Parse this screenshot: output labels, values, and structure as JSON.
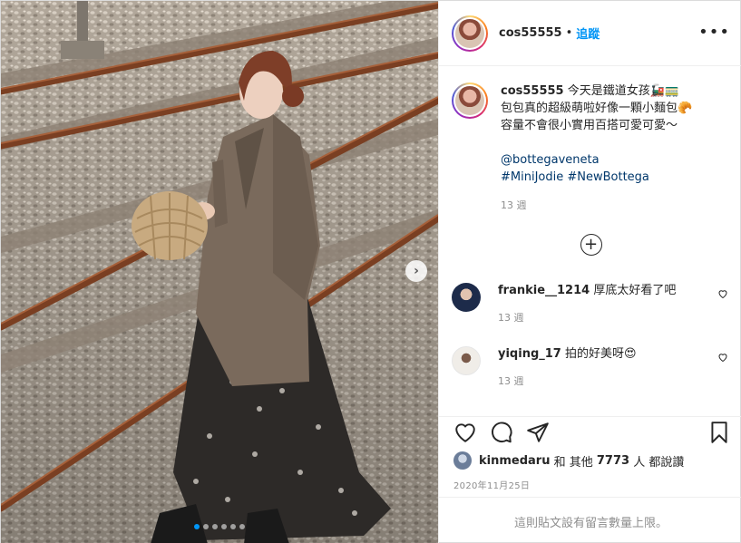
{
  "post": {
    "username": "cos55555",
    "header_separator": "•",
    "follow_label": "追蹤",
    "more_label": "•••",
    "next_label": "›",
    "slide_count": 6,
    "active_slide": 0
  },
  "caption": {
    "username": "cos55555",
    "lines": [
      "今天是鐵道女孩🚂🚃",
      "包包真的超級萌啦好像一顆小麵包🥐",
      "容量不會很小實用百搭可愛可愛～"
    ],
    "mention": "@bottegaveneta",
    "hashtags": "#MiniJodie #NewBottega",
    "time": "13 週"
  },
  "load_more_label": "+",
  "comments": [
    {
      "username": "frankie__1214",
      "text": "厚底太好看了吧",
      "time": "13 週"
    },
    {
      "username": "yiqing_17",
      "text": "拍的好美呀😍",
      "time": "13 週"
    }
  ],
  "likes": {
    "liker": "kinmedaru",
    "connector": "和 其他",
    "count": "7773",
    "suffix": "人 都說讚"
  },
  "date": "2020年11月25日",
  "comments_closed": "這則貼文設有留言數量上限。",
  "icons": {
    "like": "heart-icon",
    "comment": "comment-icon",
    "share": "paper-plane-icon",
    "save": "bookmark-icon"
  },
  "colors": {
    "accent": "#0095f6",
    "link": "#00376b",
    "muted": "#8e8e8e",
    "divider": "#efefef"
  }
}
